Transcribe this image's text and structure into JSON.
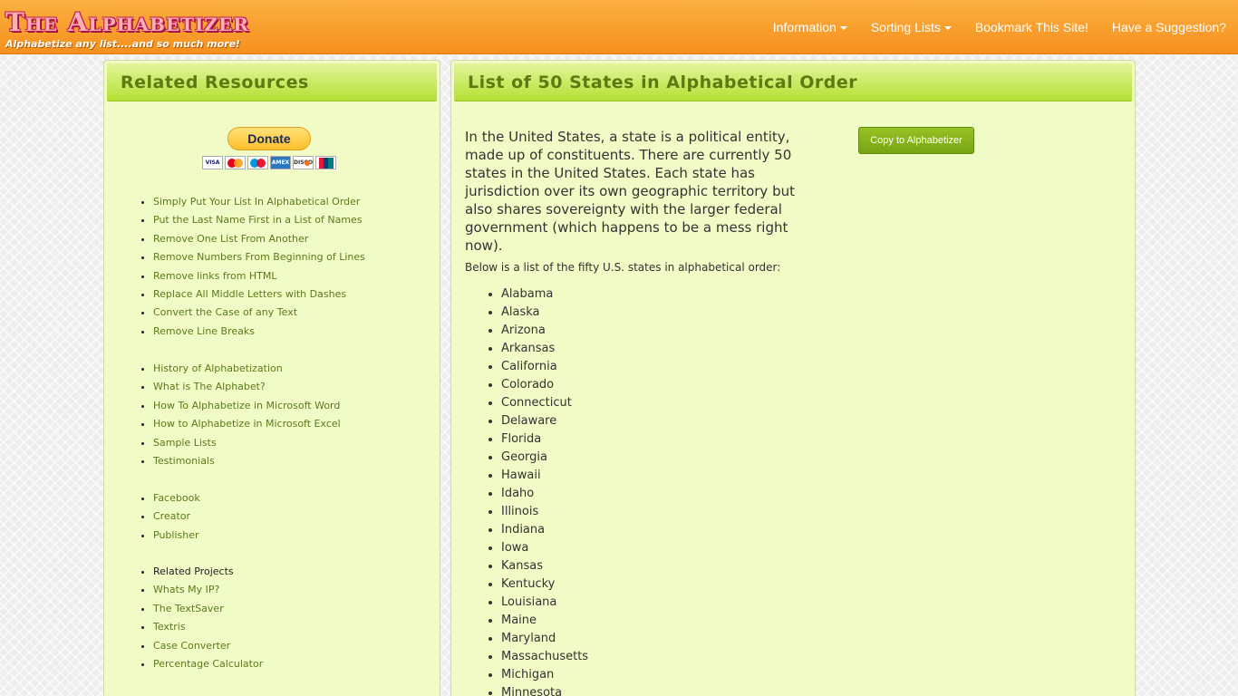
{
  "brand": {
    "title": "The Alphabetizer",
    "subtitle": "Alphabetize any list....and so much more!"
  },
  "nav": {
    "items": [
      {
        "label": "Information",
        "dropdown": true
      },
      {
        "label": "Sorting Lists",
        "dropdown": true
      },
      {
        "label": "Bookmark This Site!",
        "dropdown": false
      },
      {
        "label": "Have a Suggestion?",
        "dropdown": false
      }
    ]
  },
  "sidebar": {
    "title": "Related Resources",
    "donate_label": "Donate",
    "cards": [
      "VISA",
      "MasterCard",
      "Maestro",
      "AMEX",
      "DISCOVER",
      "UnionPay"
    ],
    "group1": [
      "Simply Put Your List In Alphabetical Order",
      "Put the Last Name First in a List of Names",
      "Remove One List From Another",
      "Remove Numbers From Beginning of Lines",
      "Remove links from HTML",
      "Replace All Middle Letters with Dashes",
      "Convert the Case of any Text",
      "Remove Line Breaks"
    ],
    "group2": [
      "History of Alphabetization",
      "What is The Alphabet?",
      "How To Alphabetize in Microsoft Word",
      "How to Alphabetize in Microsoft Excel",
      "Sample Lists",
      "Testimonials"
    ],
    "group3": [
      "Facebook",
      "Creator",
      "Publisher"
    ],
    "group4_heading": "Related Projects",
    "group4": [
      "Whats My IP?",
      "The TextSaver",
      "Textris",
      "Case Converter",
      "Percentage Calculator"
    ]
  },
  "main": {
    "title": "List of 50 States in Alphabetical Order",
    "intro": "In the United States, a state is a political entity, made up of constituents. There are currently 50 states in the United States. Each state has jurisdiction over its own geographic territory but also shares sovereignty with the larger federal government (which happens to be a mess right now).",
    "subline": "Below is a list of the fifty U.S. states in alphabetical order:",
    "copy_button": "Copy to Alphabetizer",
    "states": [
      "Alabama",
      "Alaska",
      "Arizona",
      "Arkansas",
      "California",
      "Colorado",
      "Connecticut",
      "Delaware",
      "Florida",
      "Georgia",
      "Hawaii",
      "Idaho",
      "Illinois",
      "Indiana",
      "Iowa",
      "Kansas",
      "Kentucky",
      "Louisiana",
      "Maine",
      "Maryland",
      "Massachusetts",
      "Michigan",
      "Minnesota"
    ]
  }
}
